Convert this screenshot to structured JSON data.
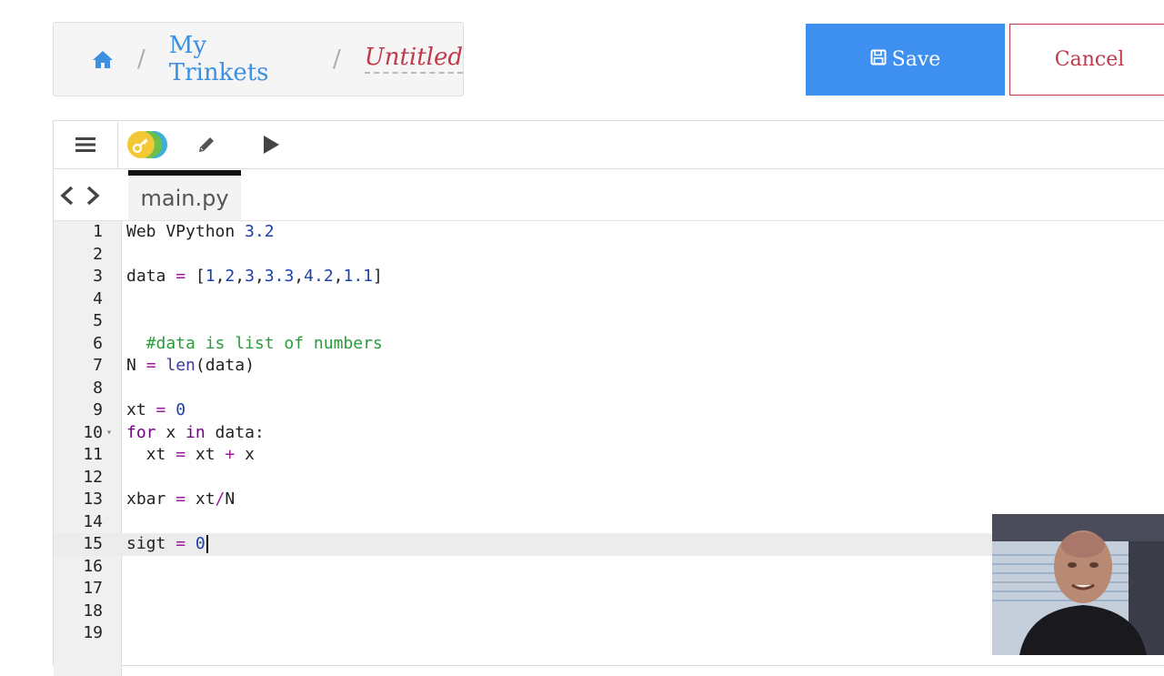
{
  "breadcrumb": {
    "home_icon": "home-icon",
    "separator": "/",
    "my_trinkets": "My Trinkets",
    "current": "Untitled"
  },
  "actions": {
    "save_label": "Save",
    "save_icon": "floppy-disk-icon",
    "cancel_label": "Cancel"
  },
  "toolbar": {
    "menu_icon": "hamburger-menu-icon",
    "keys_icon": "key-icon",
    "edit_icon": "pencil-icon",
    "run_icon": "play-icon"
  },
  "tabs": [
    {
      "label": "main.py",
      "active": true
    }
  ],
  "editor": {
    "active_line": 15,
    "lines": [
      {
        "n": "1",
        "text": "Web VPython 3.2"
      },
      {
        "n": "2",
        "text": ""
      },
      {
        "n": "3",
        "text": "data = [1,2,3,3.3,4.2,1.1]"
      },
      {
        "n": "4",
        "text": ""
      },
      {
        "n": "5",
        "text": ""
      },
      {
        "n": "6",
        "text": "  #data is list of numbers"
      },
      {
        "n": "7",
        "text": "N = len(data)"
      },
      {
        "n": "8",
        "text": ""
      },
      {
        "n": "9",
        "text": "xt = 0"
      },
      {
        "n": "10",
        "text": "for x in data:"
      },
      {
        "n": "11",
        "text": "  xt = xt + x"
      },
      {
        "n": "12",
        "text": ""
      },
      {
        "n": "13",
        "text": "xbar = xt/N"
      },
      {
        "n": "14",
        "text": ""
      },
      {
        "n": "15",
        "text": "sigt = 0"
      },
      {
        "n": "16",
        "text": ""
      },
      {
        "n": "17",
        "text": ""
      },
      {
        "n": "18",
        "text": ""
      },
      {
        "n": "19",
        "text": ""
      }
    ]
  },
  "colors": {
    "accent_blue": "#3d8ff0",
    "cancel_red": "#c0394b",
    "keyword_purple": "#770088",
    "comment_green": "#2a9d3a",
    "number_blue": "#1d3fa8"
  }
}
